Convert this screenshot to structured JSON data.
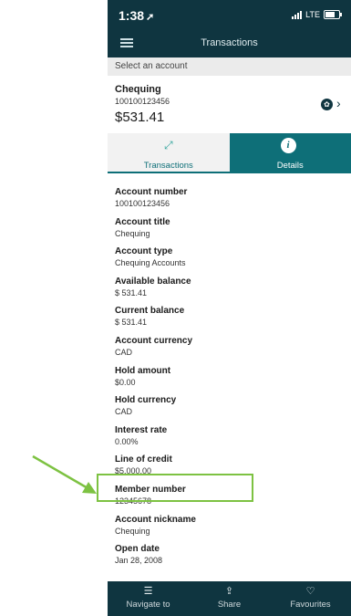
{
  "status": {
    "time": "1:38",
    "network": "LTE"
  },
  "header": {
    "title": "Transactions"
  },
  "account_selector": {
    "label": "Select an account"
  },
  "account": {
    "name": "Chequing",
    "number": "100100123456",
    "balance": "$531.41"
  },
  "tabs": [
    {
      "label": "Transactions",
      "icon": "expand-arrows-icon",
      "active": false
    },
    {
      "label": "Details",
      "icon": "info-icon",
      "active": true
    }
  ],
  "details": [
    {
      "label": "Account number",
      "value": "100100123456"
    },
    {
      "label": "Account title",
      "value": "Chequing"
    },
    {
      "label": "Account type",
      "value": "Chequing Accounts"
    },
    {
      "label": "Available balance",
      "value": "$ 531.41"
    },
    {
      "label": "Current balance",
      "value": "$ 531.41"
    },
    {
      "label": "Account currency",
      "value": "CAD"
    },
    {
      "label": "Hold amount",
      "value": "$0.00"
    },
    {
      "label": "Hold currency",
      "value": "CAD"
    },
    {
      "label": "Interest rate",
      "value": "0.00%"
    },
    {
      "label": "Line of credit",
      "value": "$5,000.00"
    },
    {
      "label": "Member number",
      "value": "12345678"
    },
    {
      "label": "Account nickname",
      "value": "Chequing"
    },
    {
      "label": "Open date",
      "value": "Jan 28, 2008"
    }
  ],
  "bottom_nav": [
    {
      "label": "Navigate to",
      "icon": "list-icon"
    },
    {
      "label": "Share",
      "icon": "share-icon"
    },
    {
      "label": "Favourites",
      "icon": "heart-icon"
    }
  ],
  "colors": {
    "header_bg": "#0f3540",
    "accent": "#0e6f78",
    "highlight": "#7dc242"
  }
}
